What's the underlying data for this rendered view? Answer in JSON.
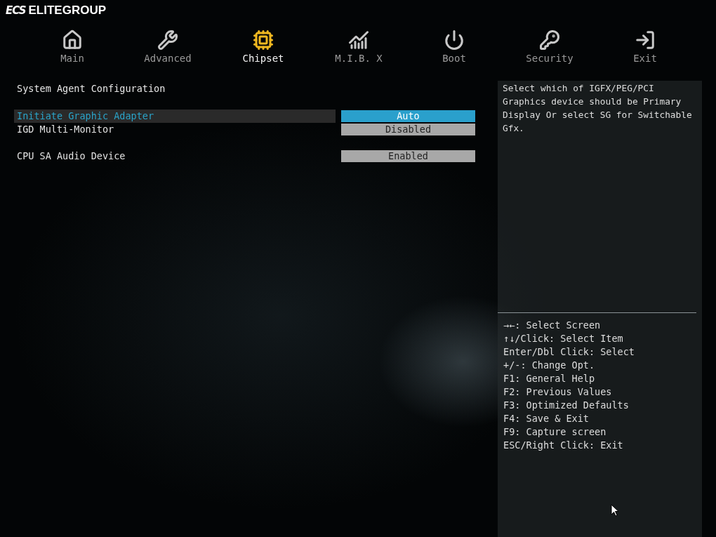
{
  "brand": {
    "mark": "ECS",
    "name": "ELITEGROUP"
  },
  "tabs": [
    {
      "label": "Main",
      "selected": false
    },
    {
      "label": "Advanced",
      "selected": false
    },
    {
      "label": "Chipset",
      "selected": true
    },
    {
      "label": "M.I.B. X",
      "selected": false
    },
    {
      "label": "Boot",
      "selected": false
    },
    {
      "label": "Security",
      "selected": false
    },
    {
      "label": "Exit",
      "selected": false
    }
  ],
  "section_title": "System Agent Configuration",
  "setting_groups": [
    [
      {
        "label": "Initiate Graphic Adapter",
        "value": "Auto",
        "selected": true
      },
      {
        "label": "IGD Multi-Monitor",
        "value": "Disabled",
        "selected": false
      }
    ],
    [
      {
        "label": "CPU SA Audio Device",
        "value": "Enabled",
        "selected": false
      }
    ]
  ],
  "help_text": "Select which of IGFX/PEG/PCI Graphics device should be Primary Display Or select SG for Switchable Gfx.",
  "key_hints": [
    "→←: Select Screen",
    "↑↓/Click: Select Item",
    "Enter/Dbl Click: Select",
    "+/-: Change Opt.",
    "F1: General Help",
    "F2: Previous Values",
    "F3: Optimized Defaults",
    "F4: Save & Exit",
    "F9: Capture screen",
    "ESC/Right Click: Exit"
  ]
}
